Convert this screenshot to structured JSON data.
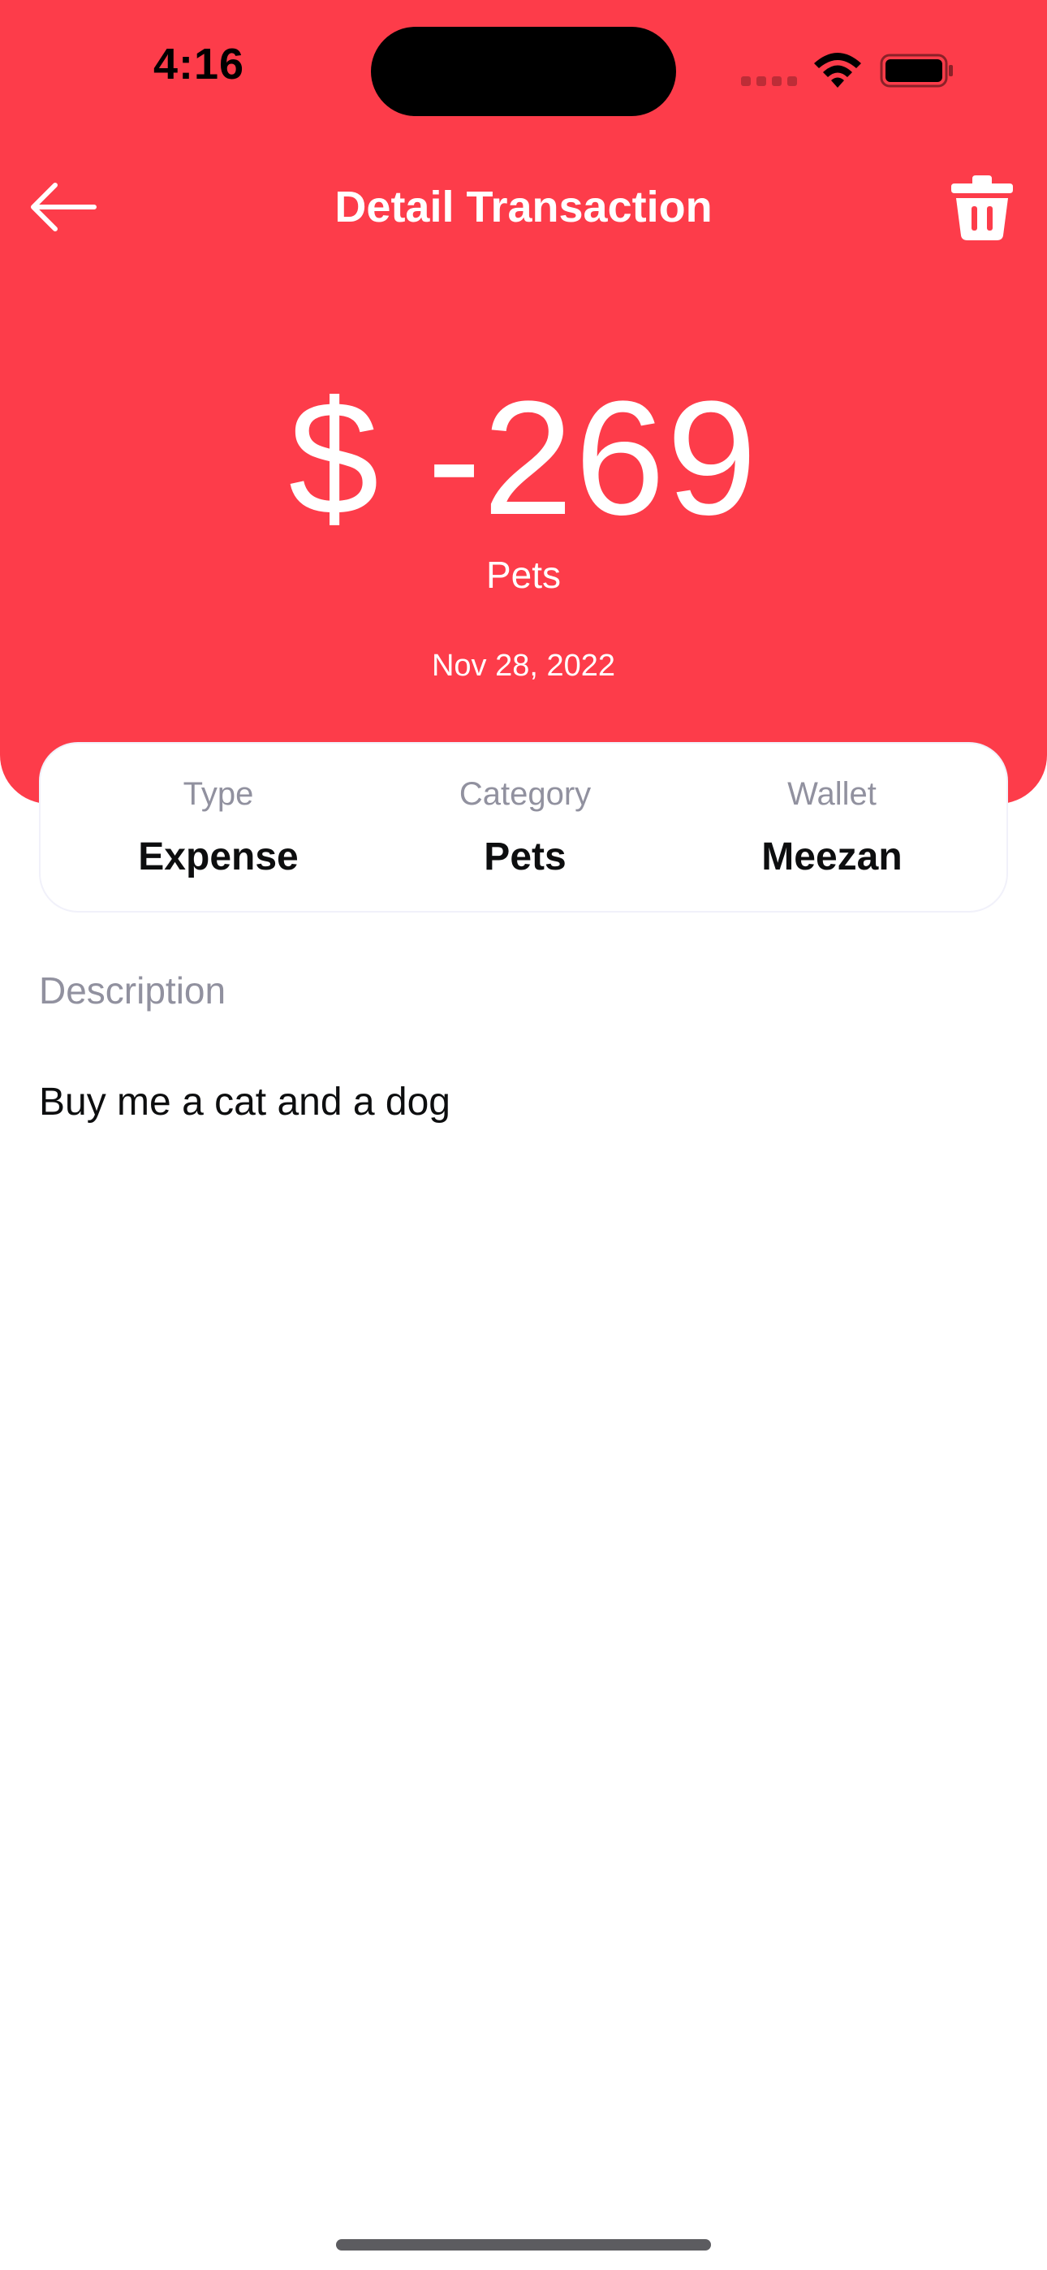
{
  "theme": {
    "accent": "#fd3c4a",
    "text_primary": "#0d0e0f",
    "text_secondary": "#91919f",
    "on_accent": "#ffffff"
  },
  "status_bar": {
    "time": "4:16"
  },
  "nav": {
    "title": "Detail Transaction",
    "back_icon": "arrow-left-icon",
    "delete_icon": "trash-icon"
  },
  "transaction": {
    "amount": "$ -269",
    "category": "Pets",
    "date": "Nov 28, 2022"
  },
  "info_card": {
    "type_label": "Type",
    "type_value": "Expense",
    "category_label": "Category",
    "category_value": "Pets",
    "wallet_label": "Wallet",
    "wallet_value": "Meezan"
  },
  "description": {
    "label": "Description",
    "text": "Buy me a cat and a dog"
  }
}
